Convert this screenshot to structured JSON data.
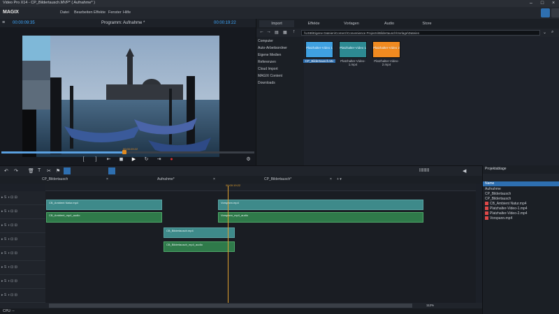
{
  "window": {
    "title": "Video Pro X14 - CP_Bildertausch.MVP* ( Aufnahme* )"
  },
  "menu": {
    "logo": "MAGIX",
    "items": [
      "Datei",
      "Bearbeiten",
      "Effekte",
      "Fenster",
      "Hilfe"
    ]
  },
  "preview": {
    "timecode_left": "00:00:09:35",
    "title": "Programm: Aufnahme *",
    "timecode_right": "00:00:19:22",
    "scrub_marker": "00:00:09:22"
  },
  "media": {
    "tabs": [
      "Import",
      "Effekte",
      "Vorlagen",
      "Audio",
      "Store"
    ],
    "path": "\\\\USB\\Eigene Dateien\\Comerz\\Convenience Projects\\Bildertausch\\Vorlage\\Dateien",
    "nav": [
      "Computer",
      "Auto-Arbeitsordner",
      "Eigene Medien",
      "Referenzen",
      "Cloud Import",
      "MAGIX Content",
      "Downloads"
    ],
    "items": [
      {
        "thumb": "Platzhalter-Video 1",
        "caption": "CP_Bildertausch.Mv",
        "color": "#3fa0e0",
        "selected": true
      },
      {
        "thumb": "Platzhalter-Video 1",
        "caption": "Platzhalter-Video-1.mp4",
        "color": "#2d8a92",
        "selected": false
      },
      {
        "thumb": "Platzhalter-Video 2",
        "caption": "Platzhalter-Video-2.mp4",
        "color": "#f08a20",
        "selected": false
      }
    ]
  },
  "timeline": {
    "tabs": [
      "CP_Bildertausch",
      "Aufnahme*",
      "CP_Bildertausch*"
    ],
    "ruler_time": "00:00:19:22",
    "clips": [
      {
        "name": "CB_Ambient Natur.mp4",
        "track": 1
      },
      {
        "name": "CB_Ambient_mp4_audio",
        "track": 2
      },
      {
        "name": "Vorspann.mp4",
        "track": 1
      },
      {
        "name": "Vorspann_mp4_audio",
        "track": 2
      },
      {
        "name": "CB_Bildertausch.mp4",
        "track": 3
      },
      {
        "name": "CB_Bildertausch_mp4_audio",
        "track": 4
      }
    ],
    "zoom": "112%"
  },
  "project": {
    "header": "Projektablage",
    "column": "Name",
    "items": [
      "Aufnahme",
      "CP_Bildertausch",
      "CP_Bildertausch",
      "CB_Ambient Natur.mp4",
      "Platzhalter-Video-1.mp4",
      "Platzhalter-Video-2.mp4",
      "Vorspann.mp4"
    ]
  },
  "status": {
    "cpu": "CPU: --"
  }
}
